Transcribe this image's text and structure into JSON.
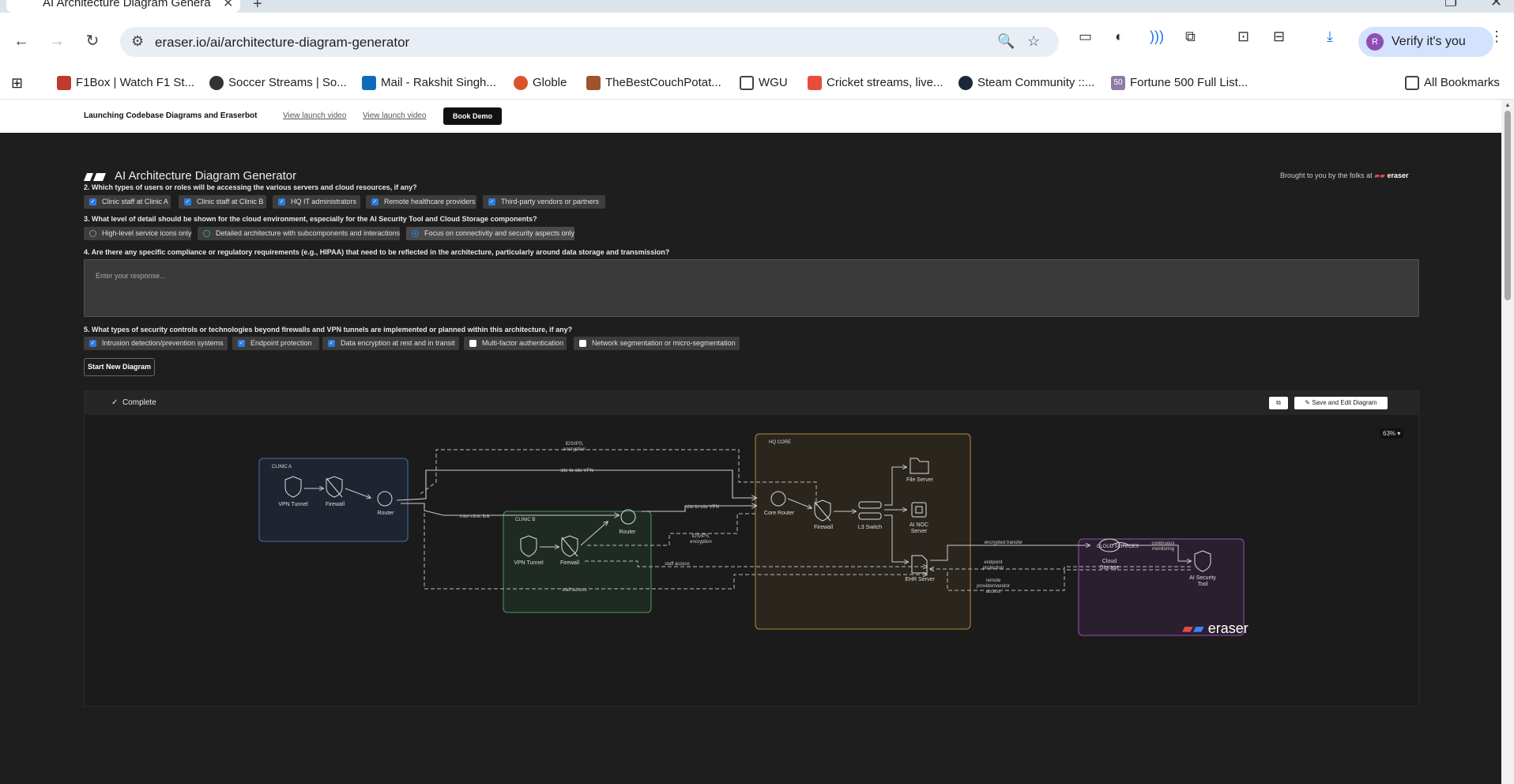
{
  "browser": {
    "tab_title": "AI Architecture Diagram Genera",
    "url": "eraser.io/ai/architecture-diagram-generator",
    "profile_label": "Verify it's you",
    "profile_initial": "R",
    "bookmarks": [
      "F1Box | Watch F1 St...",
      "Soccer Streams | So...",
      "Mail - Rakshit Singh...",
      "Globle",
      "TheBestCouchPotat...",
      "WGU",
      "Cricket streams, live...",
      "Steam Community ::...",
      "Fortune 500 Full List...",
      "All Bookmarks"
    ],
    "fortune_badge": "50"
  },
  "banner": {
    "text": "Launching Codebase Diagrams and Eraserbot",
    "link1": "View launch video",
    "link2": "View launch video",
    "cta": "Book Demo"
  },
  "app": {
    "title": "AI Architecture Diagram Generator",
    "brought_prefix": "Brought to you by the folks at",
    "brought_brand": "eraser"
  },
  "questions": {
    "q2": {
      "text": "2. Which types of users or roles will be accessing the various servers and cloud resources, if any?",
      "options": [
        {
          "label": "Clinic staff at Clinic A",
          "checked": true
        },
        {
          "label": "Clinic staff at Clinic B",
          "checked": true
        },
        {
          "label": "HQ IT administrators",
          "checked": true
        },
        {
          "label": "Remote healthcare providers",
          "checked": true
        },
        {
          "label": "Third-party vendors or partners",
          "checked": true
        }
      ]
    },
    "q3": {
      "text": "3. What level of detail should be shown for the cloud environment, especially for the AI Security Tool and Cloud Storage components?",
      "options": [
        {
          "label": "High-level service icons only",
          "selected": false
        },
        {
          "label": "Detailed architecture with subcomponents and interactions",
          "selected": false
        },
        {
          "label": "Focus on connectivity and security aspects only",
          "selected": true
        }
      ]
    },
    "q4": {
      "text": "4. Are there any specific compliance or regulatory requirements (e.g., HIPAA) that need to be reflected in the architecture, particularly around data storage and transmission?",
      "placeholder": "Enter your response..."
    },
    "q5": {
      "text": "5. What types of security controls or technologies beyond firewalls and VPN tunnels are implemented or planned within this architecture, if any?",
      "options": [
        {
          "label": "Intrusion detection/prevention systems",
          "checked": true
        },
        {
          "label": "Endpoint protection",
          "checked": true
        },
        {
          "label": "Data encryption at rest and in transit",
          "checked": true
        },
        {
          "label": "Multi-factor authentication",
          "checked": false
        },
        {
          "label": "Network segmentation or micro-segmentation",
          "checked": false
        }
      ]
    }
  },
  "start_button": "Start New Diagram",
  "panel": {
    "status": "Complete",
    "save_label": "Save and Edit Diagram",
    "zoom": "63%",
    "watermark": "eraser"
  },
  "diagram": {
    "groups": {
      "clinic_a": "CLINIC A",
      "clinic_b": "CLINIC B",
      "hq": "HQ CORE",
      "cloud": "CLOUD SERVICES"
    },
    "nodes": {
      "vpn_a": "VPN Tunnel",
      "fw_a": "Firewall",
      "router_a": "Router",
      "vpn_b": "VPN Tunnel",
      "fw_b": "Firewall",
      "router_b": "Router",
      "core_router": "Core Router",
      "hq_fw": "Firewall",
      "l3": "L3 Switch",
      "file_server": "File Server",
      "noc_1": "AI NOC",
      "noc_2": "Server",
      "ehr": "EHR Server",
      "cloud_1": "Cloud",
      "cloud_2": "Storage",
      "ai_1": "AI Security",
      "ai_2": "Tool"
    },
    "edges": {
      "ids_top_1": "IDS/IPS,",
      "ids_top_2": "encryption",
      "site_vpn_top": "site-to-site VPN",
      "inter_clinic": "inter-clinic link",
      "site_vpn_b": "site-to-site VPN",
      "ids_b_1": "IDS/IPS,",
      "ids_b_2": "encryption",
      "staff_access_mid": "staff access",
      "staff_access_bottom": "staff access",
      "encrypted_transfer": "encrypted transfer",
      "cont_1": "continuous",
      "cont_2": "monitoring",
      "endpoint_1": "endpoint",
      "endpoint_2": "protection",
      "remote_1": "remote",
      "remote_2": "provider/vendor",
      "remote_3": "access"
    }
  }
}
